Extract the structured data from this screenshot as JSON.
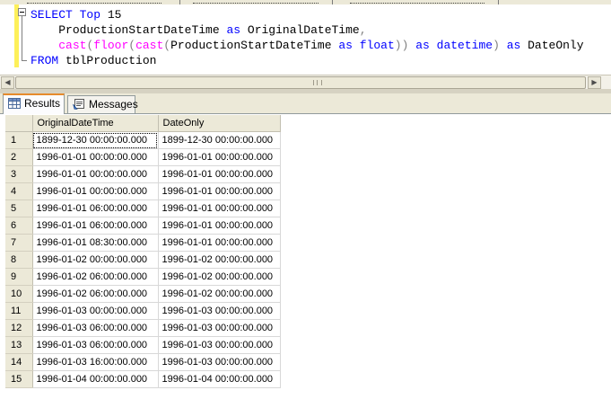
{
  "editor": {
    "lines": {
      "l1": {
        "kw1": "SELECT",
        "kw2": "Top",
        "num": "15"
      },
      "l2": {
        "col": "ProductionStartDateTime",
        "as": "as",
        "alias": "OriginalDateTime",
        "comma": ","
      },
      "l3": {
        "cast1": "cast",
        "p1": "(",
        "floor": "floor",
        "p2": "(",
        "cast2": "cast",
        "p3": "(",
        "col": "ProductionStartDateTime",
        "as1": "as",
        "t1": "float",
        "p4": "))",
        "as2": "as",
        "t2": "datetime",
        "p5": ")",
        "as3": "as",
        "alias": "DateOnly"
      },
      "l4": {
        "kw": "FROM",
        "table": "tblProduction"
      }
    }
  },
  "tabs": {
    "results": "Results",
    "messages": "Messages"
  },
  "grid": {
    "columns": [
      "OriginalDateTime",
      "DateOnly"
    ],
    "rows": [
      {
        "n": "1",
        "orig": "1899-12-30 00:00:00.000",
        "date": "1899-12-30 00:00:00.000"
      },
      {
        "n": "2",
        "orig": "1996-01-01 00:00:00.000",
        "date": "1996-01-01 00:00:00.000"
      },
      {
        "n": "3",
        "orig": "1996-01-01 00:00:00.000",
        "date": "1996-01-01 00:00:00.000"
      },
      {
        "n": "4",
        "orig": "1996-01-01 00:00:00.000",
        "date": "1996-01-01 00:00:00.000"
      },
      {
        "n": "5",
        "orig": "1996-01-01 06:00:00.000",
        "date": "1996-01-01 00:00:00.000"
      },
      {
        "n": "6",
        "orig": "1996-01-01 06:00:00.000",
        "date": "1996-01-01 00:00:00.000"
      },
      {
        "n": "7",
        "orig": "1996-01-01 08:30:00.000",
        "date": "1996-01-01 00:00:00.000"
      },
      {
        "n": "8",
        "orig": "1996-01-02 00:00:00.000",
        "date": "1996-01-02 00:00:00.000"
      },
      {
        "n": "9",
        "orig": "1996-01-02 06:00:00.000",
        "date": "1996-01-02 00:00:00.000"
      },
      {
        "n": "10",
        "orig": "1996-01-02 06:00:00.000",
        "date": "1996-01-02 00:00:00.000"
      },
      {
        "n": "11",
        "orig": "1996-01-03 00:00:00.000",
        "date": "1996-01-03 00:00:00.000"
      },
      {
        "n": "12",
        "orig": "1996-01-03 06:00:00.000",
        "date": "1996-01-03 00:00:00.000"
      },
      {
        "n": "13",
        "orig": "1996-01-03 06:00:00.000",
        "date": "1996-01-03 00:00:00.000"
      },
      {
        "n": "14",
        "orig": "1996-01-03 16:00:00.000",
        "date": "1996-01-03 00:00:00.000"
      },
      {
        "n": "15",
        "orig": "1996-01-04 00:00:00.000",
        "date": "1996-01-04 00:00:00.000"
      }
    ]
  },
  "icons": {
    "results_tab": "grid-icon",
    "messages_tab": "messages-icon",
    "collapse": "collapse-minus-icon",
    "scroll_left": "scroll-left-arrow-icon",
    "scroll_right": "scroll-right-arrow-icon"
  },
  "colors": {
    "keyword": "#0000ff",
    "function": "#ff00ff",
    "operator": "#808080",
    "change_bar": "#fdf05a",
    "active_tab_accent": "#e68b2c"
  }
}
